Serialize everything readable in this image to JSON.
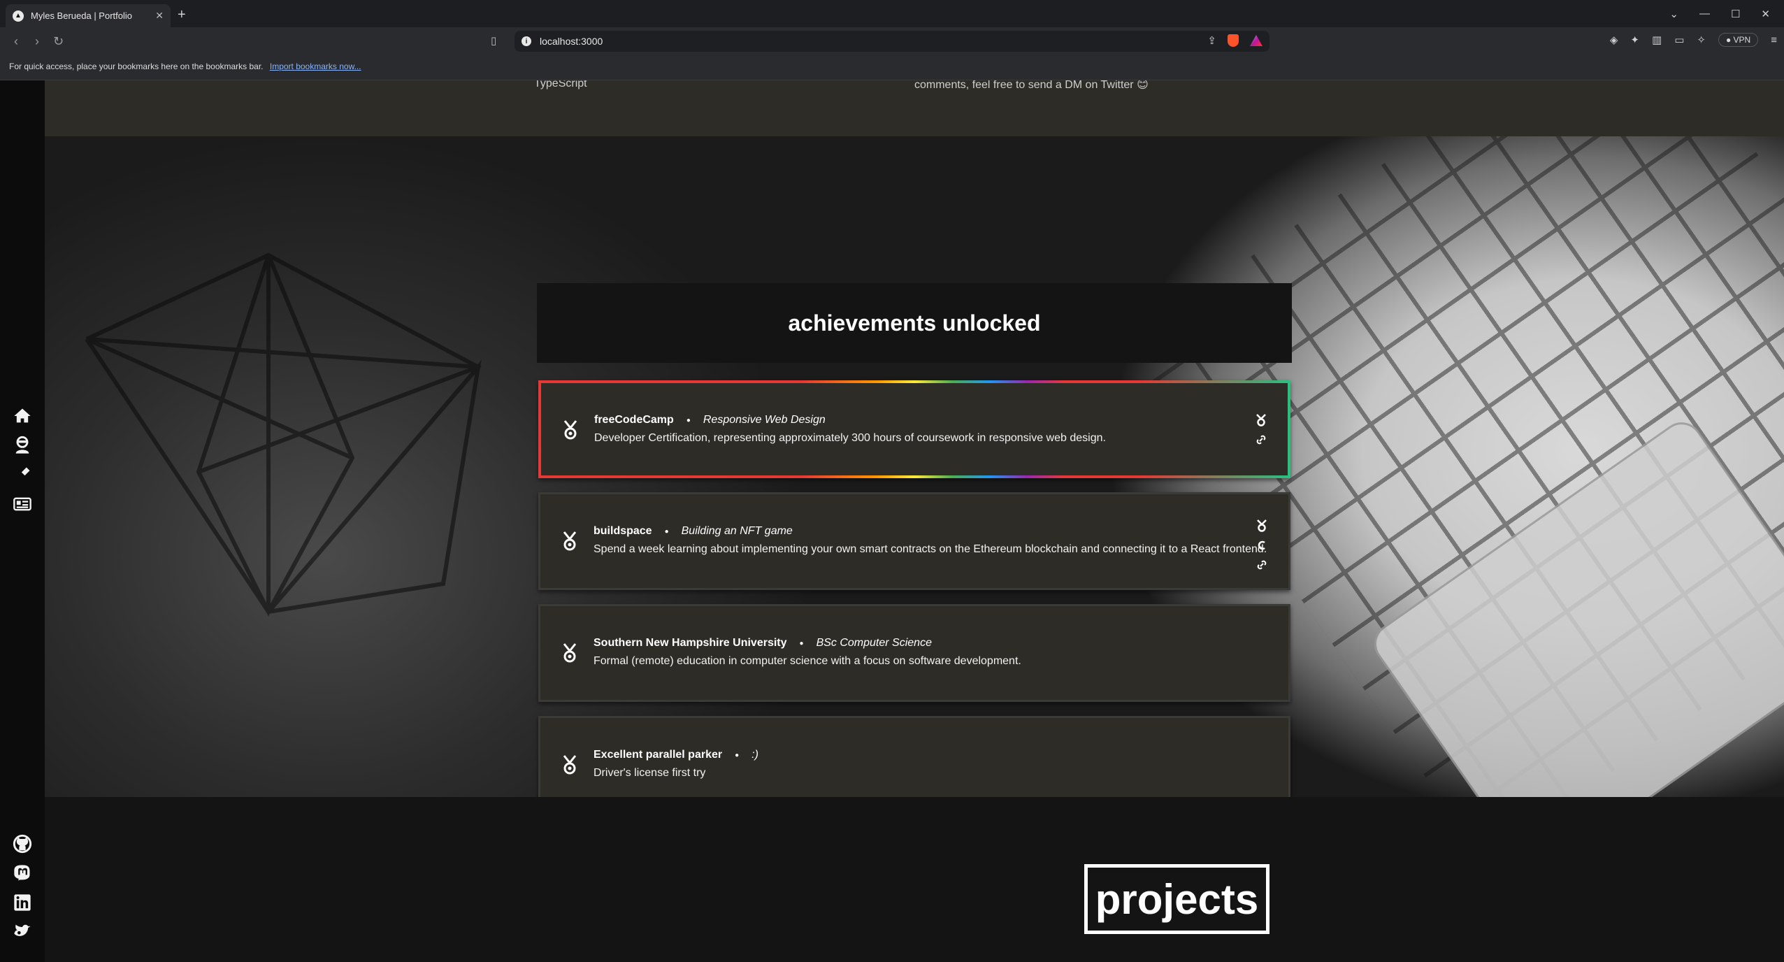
{
  "browser": {
    "tab_title": "Myles Berueda | Portfolio",
    "tab_close": "✕",
    "new_tab": "+",
    "url": "localhost:3000",
    "vpn_label": "VPN",
    "bookmarks_hint": "For quick access, place your bookmarks here on the bookmarks bar.",
    "bookmarks_import": "Import bookmarks now..."
  },
  "top_strip": {
    "left_fragment": "TypeScript",
    "right_fragment": "comments, feel free to send a DM on Twitter 😊"
  },
  "achievements": {
    "title": "achievements unlocked",
    "items": [
      {
        "name": "freeCodeCamp",
        "subtitle": "Responsive Web Design",
        "description": "Developer Certification, representing approximately 300 hours of coursework in responsive web design.",
        "actions": [
          "medal-icon",
          "link-icon"
        ]
      },
      {
        "name": "buildspace",
        "subtitle": "Building an NFT game",
        "description": "Spend a week learning about implementing your own smart contracts on the Ethereum blockchain and connecting it to a React frontend.",
        "actions": [
          "medal-icon",
          "github-icon",
          "link-icon"
        ]
      },
      {
        "name": "Southern New Hampshire University",
        "subtitle": "BSc Computer Science",
        "description": "Formal (remote) education in computer science with a focus on software development.",
        "actions": []
      },
      {
        "name": "Excellent parallel parker",
        "subtitle": ":)",
        "description": "Driver's license first try",
        "actions": []
      }
    ]
  },
  "projects": {
    "title": "projects"
  },
  "sidebar": {
    "nav": [
      "home-icon",
      "profile-icon",
      "tools-icon",
      "resume-icon"
    ],
    "social": [
      "github-icon",
      "mastodon-icon",
      "linkedin-icon",
      "twitter-icon"
    ]
  },
  "colors": {
    "page_bg": "#141414",
    "card_bg": "#2d2c27",
    "accent_red": "#e53935",
    "accent_green": "#26c281"
  }
}
